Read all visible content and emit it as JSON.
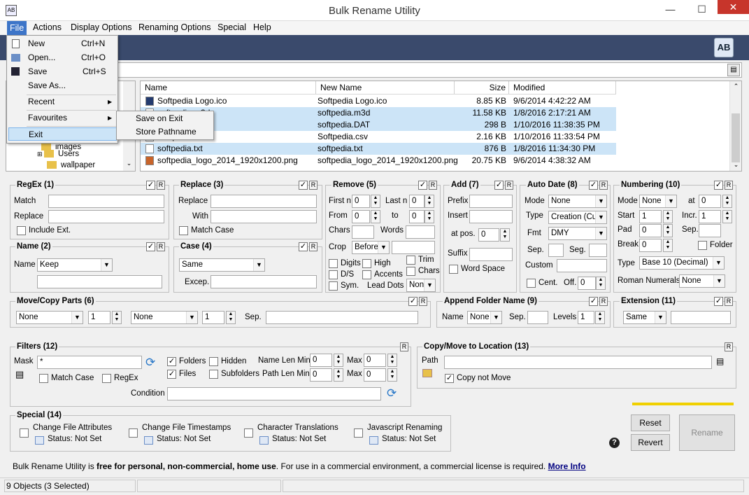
{
  "window": {
    "title": "Bulk Rename Utility",
    "minimize": "—",
    "maximize": "☐",
    "close": "✕"
  },
  "menu": [
    "File",
    "Actions",
    "Display Options",
    "Renaming Options",
    "Special",
    "Help"
  ],
  "file_menu": {
    "new": {
      "label": "New",
      "shortcut": "Ctrl+N"
    },
    "open": {
      "label": "Open...",
      "shortcut": "Ctrl+O"
    },
    "save": {
      "label": "Save",
      "shortcut": "Ctrl+S"
    },
    "save_as": "Save As...",
    "recent": "Recent",
    "favourites": "Favourites",
    "exit": "Exit",
    "sub": [
      "Save on Exit",
      "Store Pathname"
    ]
  },
  "logo": "AB",
  "tree": {
    "items": [
      "images",
      "Users",
      "wallpaper"
    ]
  },
  "file_list": {
    "columns": [
      "Name",
      "New Name",
      "Size",
      "Modified"
    ],
    "rows": [
      {
        "name": "Softpedia Logo.ico",
        "new": "Softpedia Logo.ico",
        "size": "8.85 KB",
        "modified": "9/6/2014 4:42:22 AM",
        "sel": false
      },
      {
        "name": "softpedia.m3d",
        "new": "softpedia.m3d",
        "size": "11.58 KB",
        "modified": "1/8/2016 2:17:21 AM",
        "sel": true
      },
      {
        "name": "Softpedia.DAT",
        "new": "softpedia.DAT",
        "size": "298 B",
        "modified": "1/10/2016 11:38:35 PM",
        "sel": true
      },
      {
        "name": "Softpedia.csv",
        "new": "Softpedia.csv",
        "size": "2.16 KB",
        "modified": "1/10/2016 11:33:54 PM",
        "sel": false
      },
      {
        "name": "softpedia.txt",
        "new": "softpedia.txt",
        "size": "876 B",
        "modified": "1/8/2016 11:34:30 PM",
        "sel": true
      },
      {
        "name": "softpedia_logo_2014_1920x1200.png",
        "new": "softpedia_logo_2014_1920x1200.png",
        "size": "20.75 KB",
        "modified": "9/6/2014 4:38:32 AM",
        "sel": false
      }
    ]
  },
  "regex": {
    "title": "RegEx (1)",
    "match": "Match",
    "replace": "Replace",
    "include_ext": "Include Ext."
  },
  "replace": {
    "title": "Replace (3)",
    "replace": "Replace",
    "with": "With",
    "match_case": "Match Case"
  },
  "remove": {
    "title": "Remove (5)",
    "first_n": "First n",
    "last_n": "Last n",
    "from": "From",
    "to": "to",
    "chars": "Chars",
    "words": "Words",
    "crop": "Crop",
    "crop_val": "Before",
    "trim": "Trim",
    "digits": "Digits",
    "high": "High",
    "chars2": "Chars",
    "ds": "D/S",
    "accents": "Accents",
    "sym": "Sym.",
    "lead_dots": "Lead Dots",
    "lead_val": "Non",
    "zero": "0"
  },
  "add": {
    "title": "Add (7)",
    "prefix": "Prefix",
    "insert": "Insert",
    "at_pos": "at pos.",
    "suffix": "Suffix",
    "word_space": "Word Space",
    "zero": "0"
  },
  "autodate": {
    "title": "Auto Date (8)",
    "mode": "Mode",
    "mode_val": "None",
    "type": "Type",
    "type_val": "Creation (Cur",
    "fmt": "Fmt",
    "fmt_val": "DMY",
    "sep": "Sep.",
    "seg": "Seg.",
    "custom": "Custom",
    "cent": "Cent.",
    "off": "Off.",
    "zero": "0"
  },
  "numbering": {
    "title": "Numbering (10)",
    "mode": "Mode",
    "mode_val": "None",
    "at": "at",
    "start": "Start",
    "start_val": "1",
    "incr": "Incr.",
    "incr_val": "1",
    "pad": "Pad",
    "sep": "Sep.",
    "break": "Break",
    "folder": "Folder",
    "type": "Type",
    "type_val": "Base 10 (Decimal)",
    "roman": "Roman Numerals",
    "roman_val": "None",
    "zero": "0"
  },
  "name": {
    "title": "Name (2)",
    "label": "Name",
    "val": "Keep"
  },
  "case": {
    "title": "Case (4)",
    "val": "Same",
    "excep": "Excep."
  },
  "movecopy": {
    "title": "Move/Copy Parts (6)",
    "val1": "None",
    "num1": "1",
    "val2": "None",
    "num2": "1",
    "sep": "Sep."
  },
  "append": {
    "title": "Append Folder Name (9)",
    "name": "Name",
    "name_val": "None",
    "sep": "Sep.",
    "levels": "Levels",
    "levels_val": "1"
  },
  "extension": {
    "title": "Extension (11)",
    "val": "Same"
  },
  "filters": {
    "title": "Filters (12)",
    "mask": "Mask",
    "mask_val": "*",
    "folders": "Folders",
    "hidden": "Hidden",
    "files": "Files",
    "subfolders": "Subfolders",
    "name_len_min": "Name Len Min",
    "path_len_min": "Path Len Min",
    "max": "Max",
    "match_case": "Match Case",
    "regex": "RegEx",
    "condition": "Condition",
    "zero": "0"
  },
  "copymove": {
    "title": "Copy/Move to Location (13)",
    "path": "Path",
    "copy_not_move": "Copy not Move"
  },
  "special": {
    "title": "Special (14)",
    "items": [
      {
        "label": "Change File Attributes",
        "status": "Status: Not Set"
      },
      {
        "label": "Change File Timestamps",
        "status": "Status: Not Set"
      },
      {
        "label": "Character Translations",
        "status": "Status: Not Set"
      },
      {
        "label": "Javascript Renaming",
        "status": "Status: Not Set"
      }
    ]
  },
  "buttons": {
    "reset": "Reset",
    "revert": "Revert",
    "rename": "Rename",
    "help": "?",
    "r": "R",
    "check": "✓"
  },
  "info": {
    "p1": "Bulk Rename Utility is ",
    "bold": "free for personal, non-commercial, home use",
    "p2": ". For use in a commercial environment, a commercial license is required. ",
    "link": "More Info"
  },
  "status": {
    "objects": "9 Objects (3 Selected)"
  },
  "colors": {
    "accent": "#3d75c8",
    "header_band": "#3a4a6c",
    "close": "#c7352b",
    "link": "#000080",
    "yellow": "#f0d000"
  }
}
